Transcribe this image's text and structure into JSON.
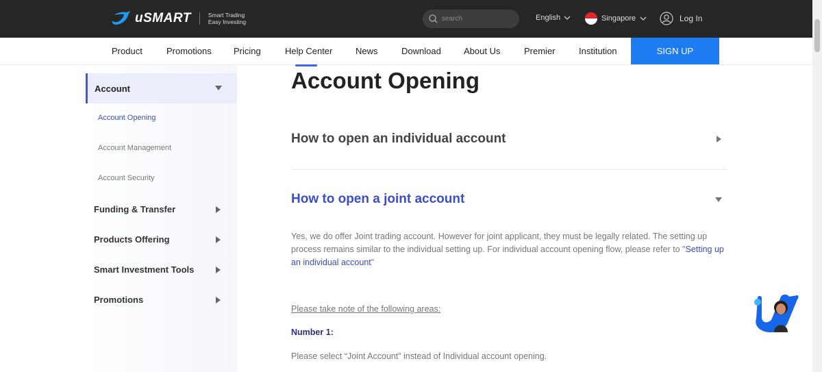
{
  "header": {
    "brand": "uSMART",
    "tagline_1": "Smart Trading",
    "tagline_2": "Easy Investing",
    "search_placeholder": "search",
    "language": "English",
    "region": "Singapore",
    "login": "Log In"
  },
  "nav": {
    "items": [
      "Product",
      "Promotions",
      "Pricing",
      "Help Center",
      "News",
      "Download",
      "About Us",
      "Premier",
      "Institution"
    ],
    "active": "Help Center",
    "signup": "SIGN UP"
  },
  "sidebar": {
    "section": "Account",
    "subitems": [
      "Account Opening",
      "Account Management",
      "Account Security"
    ],
    "active_subitem": "Account Opening",
    "categories": [
      "Funding & Transfer",
      "Products Offering",
      "Smart Investment Tools",
      "Promotions"
    ]
  },
  "main": {
    "title": "Account Opening",
    "faqs": [
      {
        "question": "How to open an individual account",
        "expanded": false
      },
      {
        "question": "How to open a joint account",
        "expanded": true
      }
    ],
    "answer_text": "Yes, we do offer Joint trading account. However for joint applicant, they must be legally related. The setting up process remains similar to the individual setting up. For individual account opening flow, please refer to \"",
    "answer_link": "Setting up an individual account",
    "answer_end": "\"",
    "note": "Please take note of the following areas: ",
    "number_label": "Number 1:",
    "number_text": "Please select “Joint Account” instead of Individual account opening."
  },
  "colors": {
    "header_bg": "#262626",
    "accent": "#3b4ec7",
    "signup_bg": "#1e7cf2"
  }
}
